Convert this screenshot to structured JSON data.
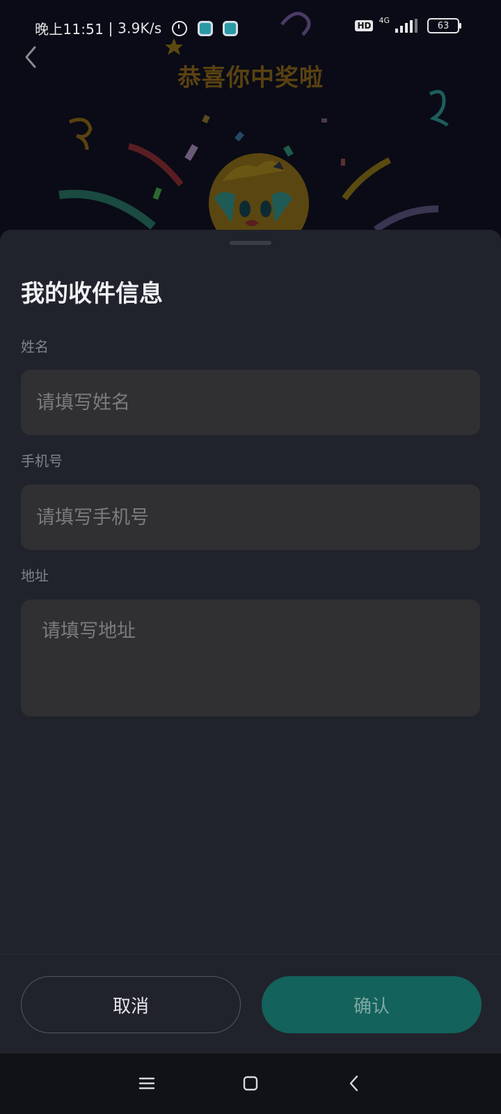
{
  "status_bar": {
    "time": "晚上11:51",
    "network_speed": "3.9K/s",
    "hd_label": "HD",
    "network_type": "4G",
    "battery": "63",
    "icons": [
      "alarm-icon",
      "app-icon",
      "app-icon",
      "hd-icon",
      "signal-icon",
      "battery-icon"
    ]
  },
  "hero": {
    "title": "恭喜你中奖啦",
    "back_icon": "back-arrow-icon"
  },
  "sheet": {
    "title": "我的收件信息",
    "fields": {
      "name": {
        "label": "姓名",
        "placeholder": "请填写姓名"
      },
      "phone": {
        "label": "手机号",
        "placeholder": "请填写手机号"
      },
      "address": {
        "label": "地址",
        "placeholder": "请填写地址"
      }
    },
    "buttons": {
      "cancel": "取消",
      "confirm": "确认"
    }
  },
  "colors": {
    "sheet_bg": "#21232c",
    "field_bg": "#303033",
    "confirm_bg": "#14625c",
    "title_gold": "#5a4210"
  },
  "nav_bar": {
    "icons": [
      "menu-icon",
      "home-icon",
      "back-icon"
    ]
  }
}
